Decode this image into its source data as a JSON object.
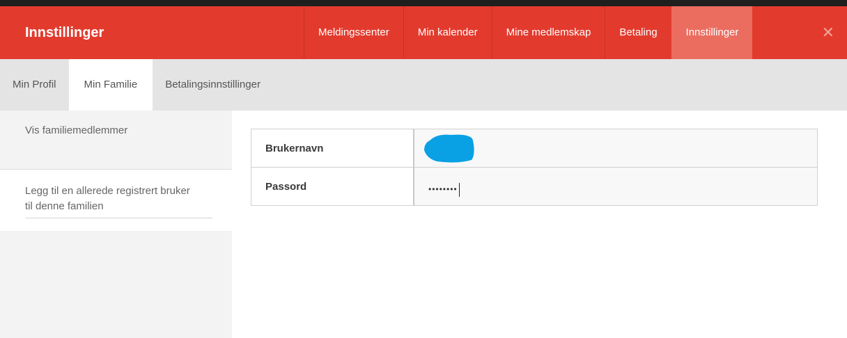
{
  "header": {
    "title": "Innstillinger",
    "nav": [
      {
        "label": "Meldingssenter"
      },
      {
        "label": "Min kalender"
      },
      {
        "label": "Mine medlemskap"
      },
      {
        "label": "Betaling"
      },
      {
        "label": "Innstillinger"
      }
    ],
    "close_glyph": "✕"
  },
  "subnav": {
    "tabs": [
      {
        "label": "Min Profil"
      },
      {
        "label": "Min Familie"
      },
      {
        "label": "Betalingsinnstillinger"
      }
    ]
  },
  "sidebar": {
    "items": [
      {
        "label": "Vis familiemedlemmer"
      },
      {
        "label": "Legg til en allerede registrert bruker til denne familien"
      }
    ]
  },
  "form": {
    "username_label": "Brukernavn",
    "password_label": "Passord",
    "password_mask": "••••••••"
  },
  "colors": {
    "brand_red": "#e23b2e",
    "active_tab": "#eb6d5f",
    "redaction_blue": "#0aa1e4"
  }
}
